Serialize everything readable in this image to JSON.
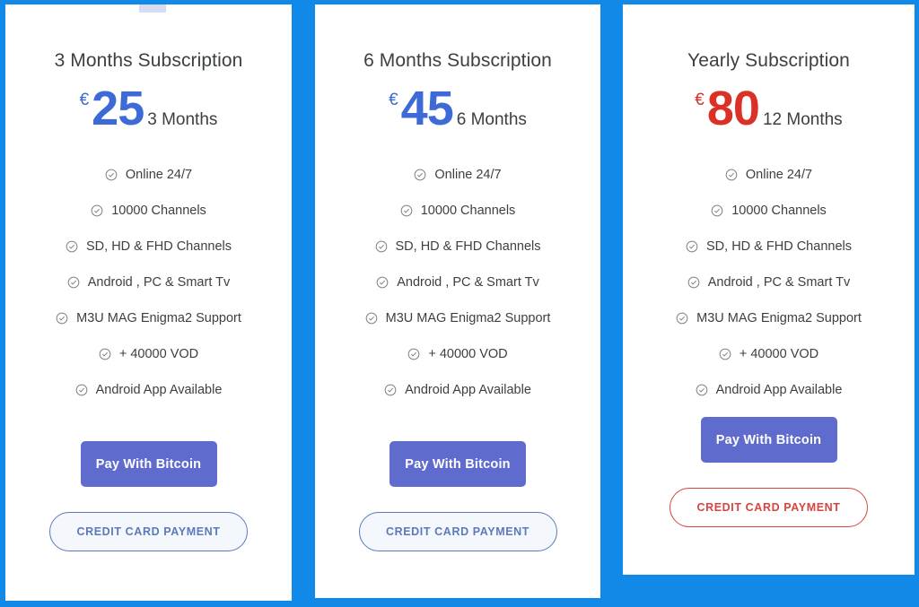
{
  "theme": {
    "background_color": "#1089e8",
    "card_background": "#ffffff",
    "price_blue": "#3d6ad6",
    "price_red": "#db3025",
    "bitcoin_button_color": "#5f6cce",
    "credit_blue_color": "#5b79bb",
    "credit_red_color": "#d8453f",
    "text_color": "#3c4043",
    "check_icon_color": "#7b7f85"
  },
  "icons": {
    "check": "check-circle-icon"
  },
  "plans": [
    {
      "title": "3 Months Subscription",
      "currency": "€",
      "amount": "25",
      "period": "3 Months",
      "accent": "blue",
      "features": [
        "Online 24/7",
        "10000 Channels",
        "SD, HD & FHD Channels",
        "Android , PC & Smart Tv",
        "M3U MAG Enigma2 Support",
        "+ 40000 VOD",
        "Android App Available"
      ],
      "bitcoin_button_label": "Pay With Bitcoin",
      "credit_button_label": "CREDIT CARD PAYMENT",
      "credit_button_style": "blue"
    },
    {
      "title": "6 Months Subscription",
      "currency": "€",
      "amount": "45",
      "period": "6 Months",
      "accent": "blue",
      "features": [
        "Online 24/7",
        "10000 Channels",
        "SD, HD & FHD Channels",
        "Android , PC & Smart Tv",
        "M3U MAG Enigma2 Support",
        "+ 40000 VOD",
        "Android App Available"
      ],
      "bitcoin_button_label": "Pay With Bitcoin",
      "credit_button_label": "CREDIT CARD PAYMENT",
      "credit_button_style": "blue"
    },
    {
      "title": "Yearly Subscription",
      "currency": "€",
      "amount": "80",
      "period": "12 Months",
      "accent": "red",
      "features": [
        "Online 24/7",
        "10000 Channels",
        "SD, HD & FHD Channels",
        "Android , PC & Smart Tv",
        "M3U MAG Enigma2 Support",
        "+ 40000 VOD",
        "Android App Available"
      ],
      "bitcoin_button_label": "Pay With Bitcoin",
      "credit_button_label": "CREDIT CARD PAYMENT",
      "credit_button_style": "red"
    }
  ]
}
